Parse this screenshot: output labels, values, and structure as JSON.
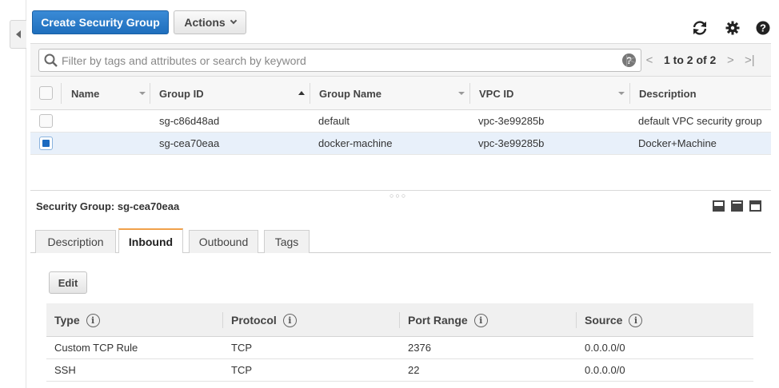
{
  "toolbar": {
    "create_label": "Create Security Group",
    "actions_label": "Actions"
  },
  "filter": {
    "placeholder": "Filter by tags and attributes or search by keyword",
    "value": ""
  },
  "pagination": {
    "text": "1 to 2 of 2"
  },
  "grid": {
    "columns": [
      "Name",
      "Group ID",
      "Group Name",
      "VPC ID",
      "Description"
    ],
    "rows": [
      {
        "name": "",
        "group_id": "sg-c86d48ad",
        "group_name": "default",
        "vpc_id": "vpc-3e99285b",
        "description": "default VPC security group",
        "selected": false
      },
      {
        "name": "",
        "group_id": "sg-cea70eaa",
        "group_name": "docker-machine",
        "vpc_id": "vpc-3e99285b",
        "description": "Docker+Machine",
        "selected": true
      }
    ]
  },
  "detail": {
    "title": "Security Group: sg-cea70eaa",
    "tabs": [
      "Description",
      "Inbound",
      "Outbound",
      "Tags"
    ],
    "active_tab": "Inbound",
    "edit_label": "Edit",
    "rules": {
      "columns": [
        "Type",
        "Protocol",
        "Port Range",
        "Source"
      ],
      "rows": [
        {
          "type": "Custom TCP Rule",
          "protocol": "TCP",
          "port_range": "2376",
          "source": "0.0.0.0/0"
        },
        {
          "type": "SSH",
          "protocol": "TCP",
          "port_range": "22",
          "source": "0.0.0.0/0"
        }
      ]
    }
  },
  "icons": {
    "refresh": "refresh-icon",
    "settings": "gear-icon",
    "help": "help-icon"
  },
  "colors": {
    "primary_button": "#1f6fbd",
    "selected_row": "#e8f0fa",
    "active_tab_accent": "#f0a14a"
  }
}
